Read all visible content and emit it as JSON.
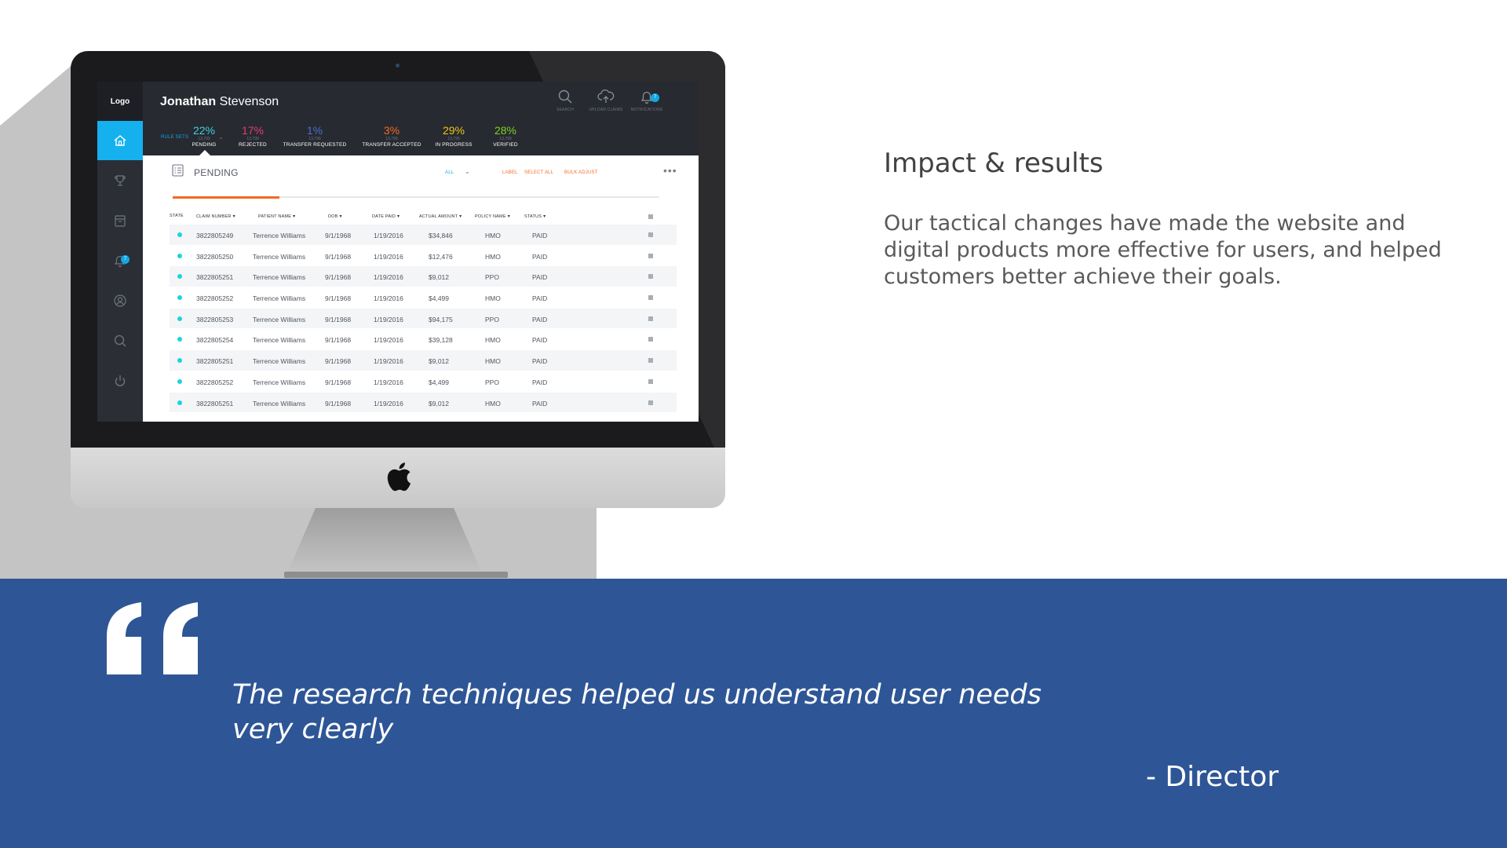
{
  "colors": {
    "accent": "#15b1ee",
    "band": "#2e5696",
    "header": "#272a31",
    "progress": "#f26a21",
    "state_dot": "#1bd3e0"
  },
  "app": {
    "logo": "Logo",
    "user_first": "Jonathan",
    "user_last": "Stevenson",
    "actions": [
      {
        "label": "SEARCH",
        "icon": "search-icon"
      },
      {
        "label": "UPLOAD CLAIMS",
        "icon": "cloud-upload-icon"
      },
      {
        "label": "NOTIFICATIONS",
        "icon": "bell-icon",
        "badge": "7"
      }
    ],
    "rule_sets": "RULE SETS",
    "stats": [
      {
        "pct": "22%",
        "count": "13,799",
        "label": "PENDING",
        "color": "#3fd3df"
      },
      {
        "pct": "17%",
        "count": "13,799",
        "label": "REJECTED",
        "color": "#e63e6d"
      },
      {
        "pct": "1%",
        "count": "13,799",
        "label": "TRANSFER REQUESTED",
        "color": "#4b6fd6"
      },
      {
        "pct": "3%",
        "count": "13,799",
        "label": "TRANSFER ACCEPTED",
        "color": "#f26a21"
      },
      {
        "pct": "29%",
        "count": "13,799",
        "label": "IN PROGRESS",
        "color": "#f1c40f"
      },
      {
        "pct": "28%",
        "count": "13,799",
        "label": "VERIFIED",
        "color": "#7ed321"
      }
    ],
    "nav": [
      {
        "icon": "home-icon",
        "active": true
      },
      {
        "icon": "trophy-icon"
      },
      {
        "icon": "archive-icon"
      },
      {
        "icon": "bell-icon",
        "badge": "7"
      },
      {
        "icon": "user-circle-icon"
      },
      {
        "icon": "search-icon"
      },
      {
        "icon": "power-icon"
      }
    ],
    "section_title": "PENDING",
    "filters": {
      "all": "ALL",
      "label": "LABEL",
      "select_all": "SELECT ALL",
      "bulk_adjust": "BULK ADJUST"
    },
    "progress_fraction": 0.22,
    "columns": [
      "STATE",
      "CLAIM NUMBER",
      "PATIENT NAME",
      "DOB",
      "DATE PAID",
      "ACTUAL AMOUNT",
      "POLICY NAME",
      "STATUS"
    ],
    "rows": [
      {
        "claim": "3822805249",
        "patient": "Terrence Williams",
        "dob": "9/1/1968",
        "paid": "1/19/2016",
        "amount": "$34,846",
        "policy": "HMO",
        "status": "PAID"
      },
      {
        "claim": "3822805250",
        "patient": "Terrence Williams",
        "dob": "9/1/1968",
        "paid": "1/19/2016",
        "amount": "$12,476",
        "policy": "HMO",
        "status": "PAID"
      },
      {
        "claim": "3822805251",
        "patient": "Terrence Williams",
        "dob": "9/1/1968",
        "paid": "1/19/2016",
        "amount": "$9,012",
        "policy": "PPO",
        "status": "PAID"
      },
      {
        "claim": "3822805252",
        "patient": "Terrence Williams",
        "dob": "9/1/1968",
        "paid": "1/19/2016",
        "amount": "$4,499",
        "policy": "HMO",
        "status": "PAID"
      },
      {
        "claim": "3822805253",
        "patient": "Terrence Williams",
        "dob": "9/1/1968",
        "paid": "1/19/2016",
        "amount": "$94,175",
        "policy": "PPO",
        "status": "PAID"
      },
      {
        "claim": "3822805254",
        "patient": "Terrence Williams",
        "dob": "9/1/1968",
        "paid": "1/19/2016",
        "amount": "$39,128",
        "policy": "HMO",
        "status": "PAID"
      },
      {
        "claim": "3822805251",
        "patient": "Terrence Williams",
        "dob": "9/1/1968",
        "paid": "1/19/2016",
        "amount": "$9,012",
        "policy": "HMO",
        "status": "PAID"
      },
      {
        "claim": "3822805252",
        "patient": "Terrence Williams",
        "dob": "9/1/1968",
        "paid": "1/19/2016",
        "amount": "$4,499",
        "policy": "PPO",
        "status": "PAID"
      },
      {
        "claim": "3822805251",
        "patient": "Terrence Williams",
        "dob": "9/1/1968",
        "paid": "1/19/2016",
        "amount": "$9,012",
        "policy": "HMO",
        "status": "PAID"
      }
    ]
  },
  "impact": {
    "title": "Impact & results",
    "body": "Our tactical changes have made the website and digital products more effective for users, and helped customers better achieve their goals."
  },
  "quote": {
    "text": "The research techniques helped us understand user needs very clearly",
    "author": "- Director"
  }
}
